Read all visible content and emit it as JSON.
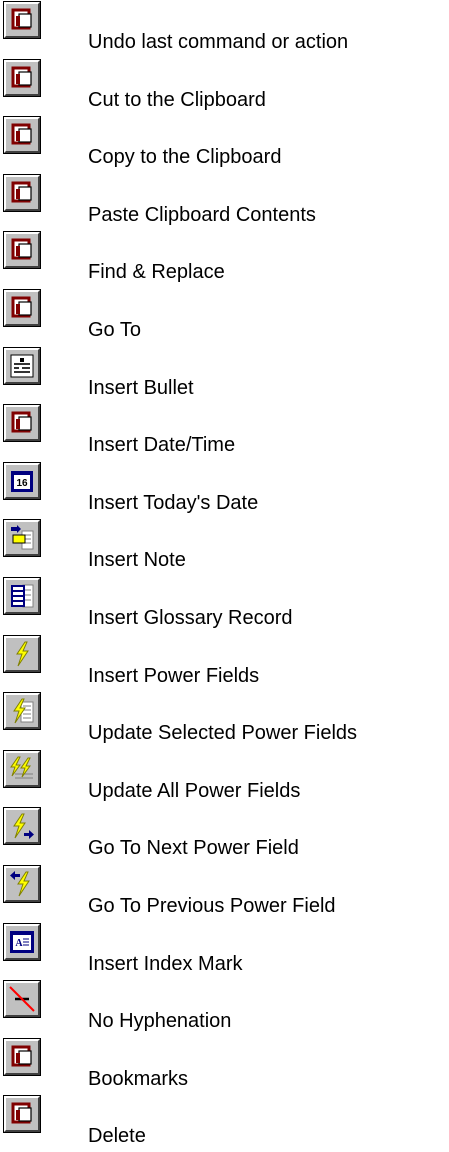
{
  "items": [
    {
      "label": "Undo last command or action",
      "icon": "placeholder-icon"
    },
    {
      "label": "Cut to the Clipboard",
      "icon": "placeholder-icon"
    },
    {
      "label": "Copy to the Clipboard",
      "icon": "placeholder-icon"
    },
    {
      "label": "Paste Clipboard Contents",
      "icon": "placeholder-icon"
    },
    {
      "label": "Find & Replace",
      "icon": "placeholder-icon"
    },
    {
      "label": "Go To",
      "icon": "placeholder-icon"
    },
    {
      "label": "Insert Bullet",
      "icon": "bullet-icon"
    },
    {
      "label": "Insert Date/Time",
      "icon": "placeholder-icon"
    },
    {
      "label": "Insert Today's Date",
      "icon": "calendar-icon"
    },
    {
      "label": "Insert Note",
      "icon": "note-icon"
    },
    {
      "label": "Insert Glossary Record",
      "icon": "glossary-icon"
    },
    {
      "label": "Insert Power Fields",
      "icon": "power-field-icon"
    },
    {
      "label": "Update Selected Power Fields",
      "icon": "update-power-field-icon"
    },
    {
      "label": "Update All Power Fields",
      "icon": "update-all-power-fields-icon"
    },
    {
      "label": "Go To Next Power Field",
      "icon": "next-power-field-icon"
    },
    {
      "label": "Go To Previous Power Field",
      "icon": "previous-power-field-icon"
    },
    {
      "label": "Insert Index Mark",
      "icon": "index-mark-icon"
    },
    {
      "label": "No Hyphenation",
      "icon": "no-hyphenation-icon"
    },
    {
      "label": "Bookmarks",
      "icon": "placeholder-icon"
    },
    {
      "label": "Delete",
      "icon": "placeholder-icon"
    }
  ],
  "calendar_day": "16"
}
